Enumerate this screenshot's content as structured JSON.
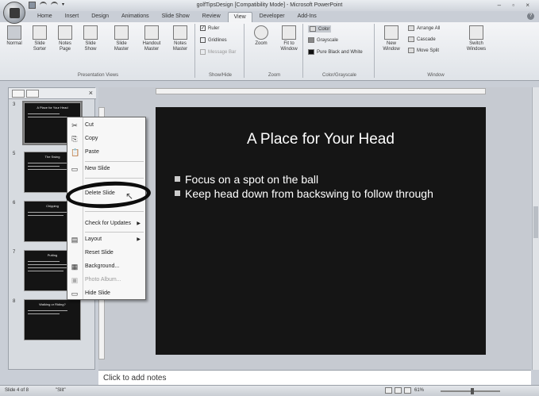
{
  "title_bar": {
    "title": "golfTipsDesign [Compatibility Mode] - Microsoft PowerPoint",
    "controls": "–  ▫  ×"
  },
  "tabs": [
    {
      "label": "Home"
    },
    {
      "label": "Insert"
    },
    {
      "label": "Design"
    },
    {
      "label": "Animations"
    },
    {
      "label": "Slide Show"
    },
    {
      "label": "Review"
    },
    {
      "label": "View"
    },
    {
      "label": "Developer"
    },
    {
      "label": "Add-Ins"
    }
  ],
  "active_tab": "View",
  "ribbon": {
    "presentation_views": {
      "label": "Presentation Views",
      "buttons": [
        {
          "label": "Normal"
        },
        {
          "label": "Slide Sorter"
        },
        {
          "label": "Notes Page"
        },
        {
          "label": "Slide Show"
        },
        {
          "label": "Slide Master"
        },
        {
          "label": "Handout Master"
        },
        {
          "label": "Notes Master"
        }
      ]
    },
    "show_hide": {
      "label": "Show/Hide",
      "ruler": "Ruler",
      "gridlines": "Gridlines",
      "message_bar": "Message Bar"
    },
    "zoom": {
      "label": "Zoom",
      "zoom_btn": "Zoom",
      "fit_btn": "Fit to Window"
    },
    "color_grayscale": {
      "label": "Color/Grayscale",
      "color": "Color",
      "grayscale": "Grayscale",
      "pure_bw": "Pure Black and White"
    },
    "window": {
      "label": "Window",
      "new_window": "New Window",
      "arrange_all": "Arrange All",
      "cascade": "Cascade",
      "move_split": "Move Split",
      "switch_windows": "Switch Windows"
    }
  },
  "slide_pane": {
    "thumbnails": [
      {
        "num": "3",
        "title": "A Place for Your Head"
      },
      {
        "num": "5",
        "title": "The Swing"
      },
      {
        "num": "6",
        "title": "Chipping"
      },
      {
        "num": "7",
        "title": "Putting"
      },
      {
        "num": "8",
        "title": "Walking or Riding?"
      }
    ]
  },
  "context_menu": {
    "items": [
      {
        "icon": "✂",
        "label": "Cut"
      },
      {
        "icon": "⎘",
        "label": "Copy"
      },
      {
        "icon": "📋",
        "label": "Paste"
      },
      {
        "icon": "▭",
        "label": "New Slide"
      },
      {
        "icon": "",
        "label": "Delete Slide"
      },
      {
        "icon": "",
        "label": "Check for Updates"
      },
      {
        "icon": "▤",
        "label": "Layout"
      },
      {
        "icon": "",
        "label": "Reset Slide"
      },
      {
        "icon": "▦",
        "label": "Background..."
      },
      {
        "icon": "▣",
        "label": "Photo Album..."
      },
      {
        "icon": "▭",
        "label": "Hide Slide"
      }
    ]
  },
  "slide": {
    "title": "A Place for Your Head",
    "bullets": [
      "Focus on a spot on the ball",
      "Keep head down from backswing to follow through"
    ]
  },
  "notes": {
    "placeholder": "Click to add notes"
  },
  "status_bar": {
    "slide_info": "Slide 4 of 8",
    "theme": "\"Slit\"",
    "zoom": "61%"
  }
}
